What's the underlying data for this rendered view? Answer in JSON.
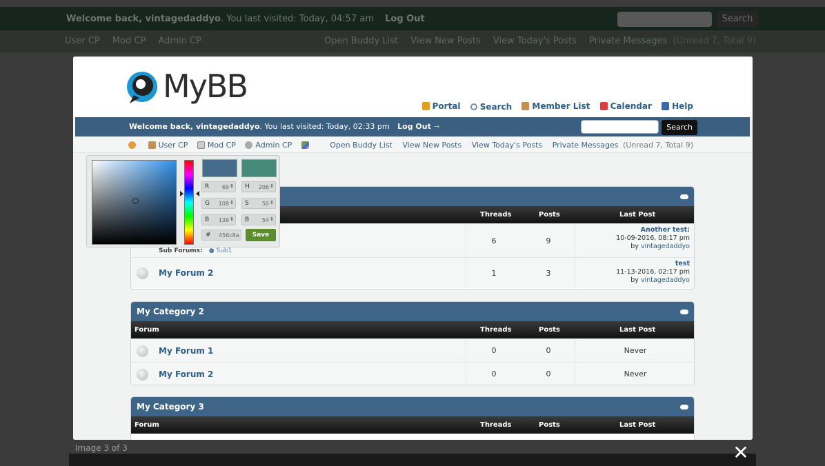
{
  "background": {
    "welcome_prefix": "Welcome back, ",
    "username": "vintagedaddyo",
    "last_visited": ". You last visited: Today, 04:57 am",
    "logout": "Log Out",
    "search_button": "Search",
    "nav_left": [
      "User CP",
      "Mod CP",
      "Admin CP"
    ],
    "nav_right": [
      "Open Buddy List",
      "View New Posts",
      "View Today's Posts",
      "Private Messages"
    ],
    "pm_counts": "(Unread 7, Total 9)"
  },
  "modal": {
    "logo_text": "MyBB",
    "toplinks": [
      {
        "label": "Portal",
        "icon": "bell-icon"
      },
      {
        "label": "Search",
        "icon": "search-icon"
      },
      {
        "label": "Member List",
        "icon": "members-icon"
      },
      {
        "label": "Calendar",
        "icon": "calendar-icon"
      },
      {
        "label": "Help",
        "icon": "help-icon"
      }
    ],
    "welcome_prefix": "Welcome back, ",
    "username": "vintagedaddyo",
    "last_visited": ". You last visited: Today, 02:33 pm",
    "logout": "Log Out",
    "search_button": "Search",
    "nav_left": [
      "User CP",
      "Mod CP",
      "Admin CP"
    ],
    "nav_right": [
      "Open Buddy List",
      "View New Posts",
      "View Today's Posts",
      "Private Messages"
    ],
    "pm_counts": "(Unread 7, Total 9)",
    "columns": {
      "forum": "Forum",
      "threads": "Threads",
      "posts": "Posts",
      "last_post": "Last Post"
    },
    "cat1": {
      "rows": [
        {
          "name": "",
          "threads": "6",
          "posts": "9",
          "last_title": "Another test:",
          "last_date": "10-09-2016, 08:17 pm",
          "by": "by ",
          "author": "vintagedaddyo",
          "sub_label": "Sub Forums:",
          "sub": "Sub1"
        },
        {
          "name": "My Forum 2",
          "threads": "1",
          "posts": "3",
          "last_title": "test",
          "last_date": "11-13-2016, 02:17 pm",
          "by": "by ",
          "author": "vintagedaddyo"
        }
      ]
    },
    "cat2": {
      "title": "My Category 2",
      "rows": [
        {
          "name": "My Forum 1",
          "threads": "0",
          "posts": "0",
          "last": "Never"
        },
        {
          "name": "My Forum 2",
          "threads": "0",
          "posts": "0",
          "last": "Never"
        }
      ]
    },
    "cat3": {
      "title": "My Category 3"
    },
    "picker": {
      "r": "69",
      "g": "108",
      "b": "138",
      "h": "206",
      "s": "50",
      "v": "54",
      "hex": "456c8a",
      "save": "Save",
      "current_color": "#456c8a",
      "new_color": "#458a7b"
    }
  },
  "lightbox": {
    "counter": "Image 3 of 3",
    "close": "✕"
  }
}
